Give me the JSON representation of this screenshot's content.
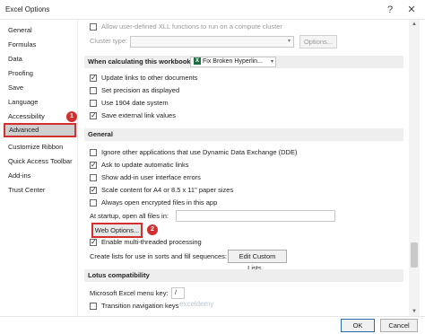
{
  "window": {
    "title": "Excel Options"
  },
  "sidebar": {
    "items": [
      {
        "label": "General"
      },
      {
        "label": "Formulas"
      },
      {
        "label": "Data"
      },
      {
        "label": "Proofing"
      },
      {
        "label": "Save"
      },
      {
        "label": "Language"
      },
      {
        "label": "Accessibility"
      },
      {
        "label": "Advanced"
      },
      {
        "label": "Customize Ribbon"
      },
      {
        "label": "Quick Access Toolbar"
      },
      {
        "label": "Add-ins"
      },
      {
        "label": "Trust Center"
      }
    ],
    "selected": "Advanced"
  },
  "top": {
    "udf_label": "Allow user-defined XLL functions to run on a compute cluster",
    "cluster_type_label": "Cluster type:",
    "cluster_options_button": "Options..."
  },
  "workbook_section": {
    "header": "When calculating this workbook:",
    "workbook_select": "Fix Broken Hyperlin...",
    "items": [
      {
        "label": "Update links to other documents",
        "checked": true
      },
      {
        "label": "Set precision as displayed",
        "checked": false
      },
      {
        "label": "Use 1904 date system",
        "checked": false
      },
      {
        "label": "Save external link values",
        "checked": true
      }
    ]
  },
  "general_section": {
    "header": "General",
    "items": [
      {
        "label": "Ignore other applications that use Dynamic Data Exchange (DDE)",
        "checked": false
      },
      {
        "label": "Ask to update automatic links",
        "checked": true
      },
      {
        "label": "Show add-in user interface errors",
        "checked": false
      },
      {
        "label": "Scale content for A4 or 8.5 x 11\" paper sizes",
        "checked": true
      },
      {
        "label": "Always open encrypted files in this app",
        "checked": false
      }
    ],
    "startup_label": "At startup, open all files in:",
    "web_options_button": "Web Options...",
    "multithread_label": "Enable multi-threaded processing",
    "multithread_checked": true,
    "custom_lists_label": "Create lists for use in sorts and fill sequences:",
    "edit_custom_lists_button": "Edit Custom Lists..."
  },
  "lotus_section": {
    "header": "Lotus compatibility",
    "menu_key_label": "Microsoft Excel menu key:",
    "menu_key_value": "/",
    "transition_label": "Transition navigation keys",
    "transition_checked": false
  },
  "footer": {
    "ok_label": "OK",
    "cancel_label": "Cancel"
  },
  "badges": {
    "one": "1",
    "two": "2"
  },
  "watermark": "exceldemy"
}
